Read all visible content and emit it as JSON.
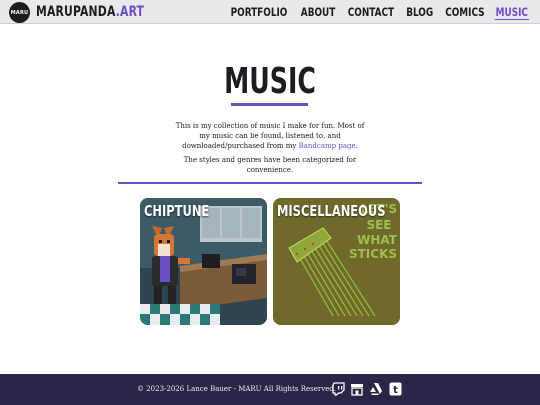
{
  "brand": {
    "mark": "MARU",
    "name": "MARUPANDA",
    "tld": ".ART"
  },
  "nav": {
    "items": [
      {
        "label": "PORTFOLIO",
        "active": false
      },
      {
        "label": "ABOUT",
        "active": false
      },
      {
        "label": "CONTACT",
        "active": false
      },
      {
        "label": "BLOG",
        "active": false
      },
      {
        "label": "COMICS",
        "active": false
      },
      {
        "label": "MUSIC",
        "active": true
      }
    ]
  },
  "page": {
    "title": "MUSIC",
    "intro_before_link": "This is my collection of music I make for fun. Most of my music can be found, listened to, and downloaded/purchased from my ",
    "intro_link": "Bandcamp page",
    "intro_after_link": ".",
    "intro2": "The styles and genres have been categorized for convenience."
  },
  "cards": [
    {
      "label": "CHIPTUNE"
    },
    {
      "label": "MISCELLANEOUS",
      "art_text": [
        "LET'S",
        "SEE",
        "WHAT",
        "STICKS"
      ]
    }
  ],
  "footer": {
    "copyright": "© 2023-2026 Lance Bauer - MARU All Rights Reserved.",
    "social": [
      "twitch-icon",
      "store-icon",
      "artstation-icon",
      "tumblr-icon"
    ]
  },
  "colors": {
    "accent": "#6a4fc0",
    "header_bg": "#e9e8ee",
    "footer_bg": "#2a2645"
  }
}
